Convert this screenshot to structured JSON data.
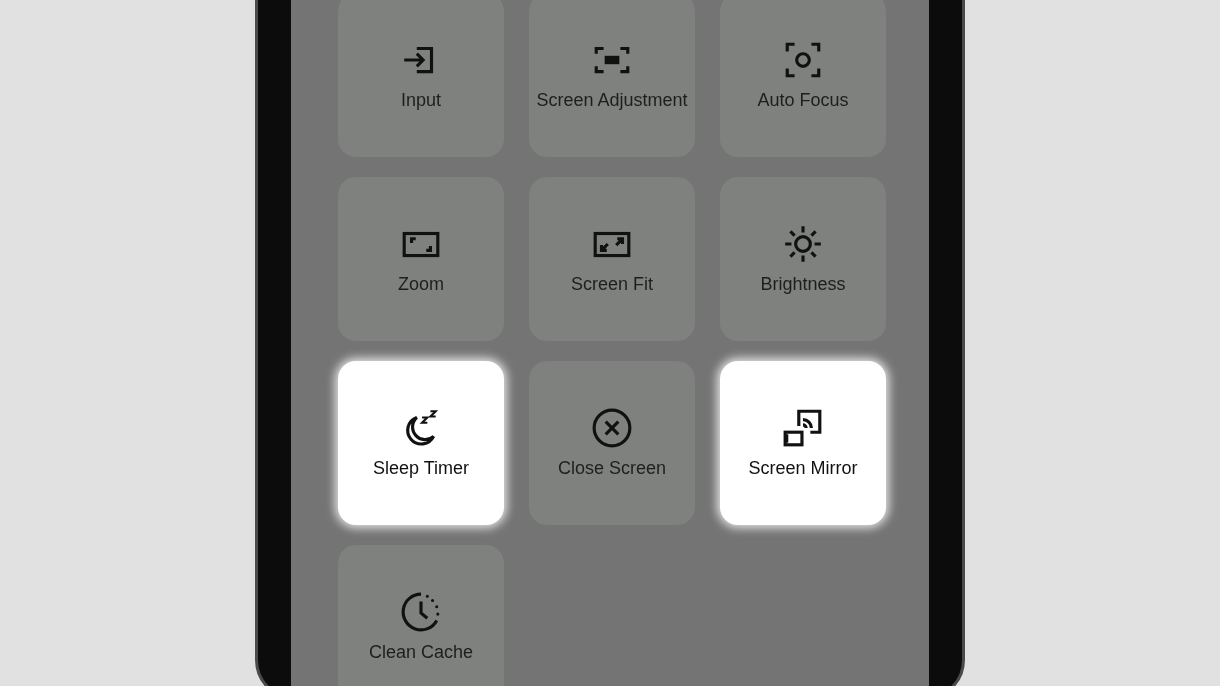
{
  "tiles": [
    {
      "label": "Input",
      "kind": "input",
      "highlighted": false
    },
    {
      "label": "Screen Adjustment",
      "kind": "adjust",
      "highlighted": false
    },
    {
      "label": "Auto Focus",
      "kind": "focus",
      "highlighted": false
    },
    {
      "label": "Zoom",
      "kind": "zoom",
      "highlighted": false
    },
    {
      "label": "Screen Fit",
      "kind": "fit",
      "highlighted": false
    },
    {
      "label": "Brightness",
      "kind": "brightness",
      "highlighted": false
    },
    {
      "label": "Sleep Timer",
      "kind": "sleep",
      "highlighted": true
    },
    {
      "label": "Close Screen",
      "kind": "close",
      "highlighted": false
    },
    {
      "label": "Screen Mirror",
      "kind": "mirror",
      "highlighted": true
    },
    {
      "label": "Clean Cache",
      "kind": "cache",
      "highlighted": false
    }
  ]
}
